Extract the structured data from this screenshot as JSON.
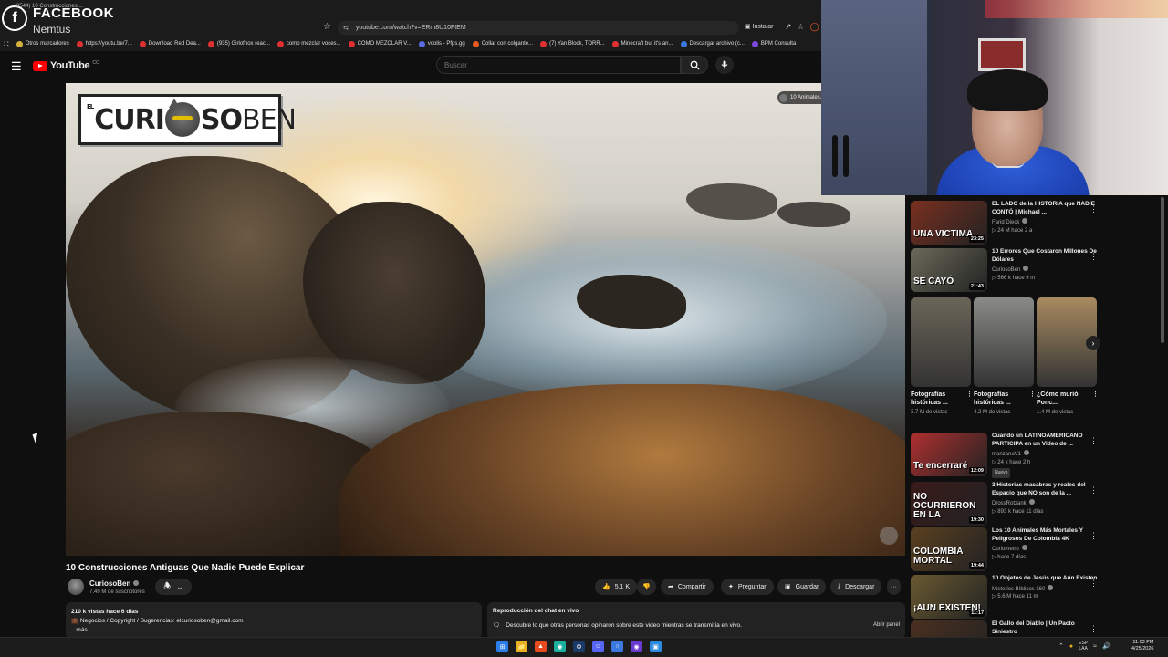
{
  "browser": {
    "tab_overlay_title": "FACEBOOK",
    "tab_overlay_sub": "Nemtus",
    "tab_small": "(3544) 10 Construcciones ...",
    "url": "youtube.com/watch?v=ERm8U10FIEM",
    "install_label": "Instalar",
    "bookmarks": [
      {
        "label": "Otros marcadores",
        "color": "#d8b040"
      },
      {
        "label": "https://youtu.be/7...",
        "color": "#e03030"
      },
      {
        "label": "Download Red Dea...",
        "color": "#e03030"
      },
      {
        "label": "(935) Girlofnox reac...",
        "color": "#e03030"
      },
      {
        "label": "como mezclar voces...",
        "color": "#e03030"
      },
      {
        "label": "COMO MEZCLAR V...",
        "color": "#e03030"
      },
      {
        "label": "voolis - Pfps.gg",
        "color": "#5a6ae8"
      },
      {
        "label": "Collar con colgante...",
        "color": "#e85a20"
      },
      {
        "label": "(7) Yan Block, TORR...",
        "color": "#e03030"
      },
      {
        "label": "Minecraft but it's an...",
        "color": "#e03030"
      },
      {
        "label": "Descargar archivo (c...",
        "color": "#3a7ae0"
      },
      {
        "label": "BPM Consulta",
        "color": "#7a4ae0"
      }
    ]
  },
  "youtube": {
    "logo_text": "YouTube",
    "country_code": "CO",
    "search_placeholder": "Buscar"
  },
  "player": {
    "watermark_el": "EL",
    "watermark_curi": "CURI",
    "watermark_soben": "SO",
    "watermark_ben": "BEN",
    "chip_label": "10 Animales..."
  },
  "video": {
    "title": "10 Construcciones Antiguas Que Nadie Puede Explicar",
    "channel": "CuriosoBen",
    "subscribers": "7.49 M de suscriptores",
    "likes": "5.1 K",
    "share": "Compartir",
    "ask": "Preguntar",
    "save": "Guardar",
    "download": "Descargar",
    "more": "···",
    "views_line": "210 k vistas  hace 6 días",
    "desc_line": "Negocios / Copyright / Sugerencias: elcuriosoben@gmail.com",
    "desc_more": "...más",
    "chat_title": "Reproducción del chat en vivo",
    "chat_text": "Descubre lo que otras personas opinaron sobre este video mientras se transmitía en vivo.",
    "chat_open": "Abrir panel"
  },
  "sidebar": {
    "recs_top": [
      {
        "title": "EL LADO de la HISTORIA que NADIE CONTÓ | Michael ...",
        "channel": "Farid Dieck",
        "meta": "24 M  hace 2 a",
        "duration": "23:25",
        "thumb_text": "UNA VICTIMA",
        "thumb_color": "#7a3020",
        "new": ""
      },
      {
        "title": "10 Errores Que Costaron Millones De Dólares",
        "channel": "CuriosoBen",
        "meta": "566 k  hace 9 m",
        "duration": "21:43",
        "thumb_text": "SE CAYÓ",
        "thumb_color": "#6a6a5a",
        "new": ""
      }
    ],
    "shorts": [
      {
        "title": "Fotografías históricas ...",
        "views": "3.7 M de vistas",
        "color": "#6a6558"
      },
      {
        "title": "Fotografías históricas ...",
        "views": "4.2 M de vistas",
        "color": "#8a8a88"
      },
      {
        "title": "¿Cómo murió Ponc...",
        "views": "1.4 M de vistas",
        "color": "#a88a60"
      }
    ],
    "recs_bottom": [
      {
        "title": "Cuando un LATINOAMERICANO PARTICIPA en un Video de ...",
        "channel": "manzanaV1",
        "meta": "24 k  hace 2 h",
        "duration": "12:09",
        "thumb_text": "Te encerraré",
        "thumb_color": "#b03030",
        "new": "Nuevo"
      },
      {
        "title": "3 Historias macabras y reales del Espacio que NO son de la ...",
        "channel": "DrossRotzank",
        "meta": "893 k  hace 11 días",
        "duration": "19:30",
        "thumb_text": "NO OCURRIERON EN LA",
        "thumb_color": "#3a1a1a",
        "new": ""
      },
      {
        "title": "Los 10 Animales Más Mortales Y Peligrosos De Colombia 4K",
        "channel": "Curiometro",
        "meta": "hace 7 días",
        "duration": "19:44",
        "thumb_text": "COLOMBIA MORTAL",
        "thumb_color": "#5a4020",
        "new": ""
      },
      {
        "title": "10 Objetos de Jesús que Aún Existen",
        "channel": "Misterios Bíblicos 360",
        "meta": "5.6 M  hace 11 m",
        "duration": "11:17",
        "thumb_text": "¡AUN EXISTEN!",
        "thumb_color": "#6a5a30",
        "new": ""
      },
      {
        "title": "El Gallo del Diablo | Un Pacto Siniestro",
        "channel": "",
        "meta": "",
        "duration": "",
        "thumb_text": "",
        "thumb_color": "#4a3020",
        "new": ""
      }
    ]
  },
  "taskbar": {
    "lang_top": "ESP",
    "lang_bottom": "LAA",
    "time": "11:03 PM",
    "date": "4/25/2026"
  }
}
